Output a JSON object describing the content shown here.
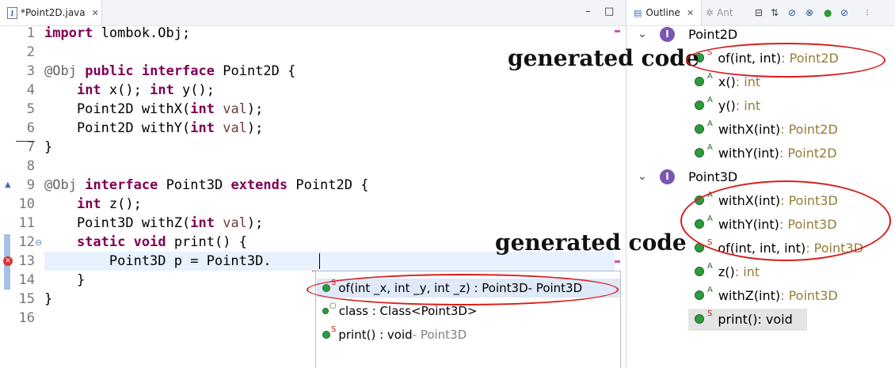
{
  "editor": {
    "tab_title": "*Point2D.java",
    "tab_close": "✕",
    "minimize": "–",
    "maximize": "□",
    "lines": [
      {
        "num": "1",
        "tokens": [
          {
            "t": "import",
            "c": "kw"
          },
          {
            "t": " lombok.Obj;",
            "c": ""
          }
        ]
      },
      {
        "num": "2",
        "tokens": []
      },
      {
        "num": "3",
        "tokens": [
          {
            "t": "@Obj",
            "c": "ann"
          },
          {
            "t": " ",
            "c": ""
          },
          {
            "t": "public",
            "c": "kw"
          },
          {
            "t": " ",
            "c": ""
          },
          {
            "t": "interface",
            "c": "kw"
          },
          {
            "t": " Point2D {",
            "c": ""
          }
        ]
      },
      {
        "num": "4",
        "tokens": [
          {
            "t": "    ",
            "c": ""
          },
          {
            "t": "int",
            "c": "kw"
          },
          {
            "t": " x(); ",
            "c": ""
          },
          {
            "t": "int",
            "c": "kw"
          },
          {
            "t": " y();",
            "c": ""
          }
        ]
      },
      {
        "num": "5",
        "tokens": [
          {
            "t": "    Point2D withX(",
            "c": ""
          },
          {
            "t": "int",
            "c": "kw"
          },
          {
            "t": " ",
            "c": ""
          },
          {
            "t": "val",
            "c": "param"
          },
          {
            "t": ");",
            "c": ""
          }
        ]
      },
      {
        "num": "6",
        "tokens": [
          {
            "t": "    Point2D withY(",
            "c": ""
          },
          {
            "t": "int",
            "c": "kw"
          },
          {
            "t": " ",
            "c": ""
          },
          {
            "t": "val",
            "c": "param"
          },
          {
            "t": ");",
            "c": ""
          }
        ]
      },
      {
        "num": "7",
        "tokens": [
          {
            "t": "}",
            "c": ""
          }
        ]
      },
      {
        "num": "8",
        "tokens": []
      },
      {
        "num": "9",
        "tokens": [
          {
            "t": "@Obj",
            "c": "ann"
          },
          {
            "t": " ",
            "c": ""
          },
          {
            "t": "interface",
            "c": "kw"
          },
          {
            "t": " Point3D ",
            "c": ""
          },
          {
            "t": "extends",
            "c": "kw"
          },
          {
            "t": " Point2D {",
            "c": ""
          }
        ]
      },
      {
        "num": "10",
        "tokens": [
          {
            "t": "    ",
            "c": ""
          },
          {
            "t": "int",
            "c": "kw"
          },
          {
            "t": " z();",
            "c": ""
          }
        ]
      },
      {
        "num": "11",
        "tokens": [
          {
            "t": "    Point3D withZ(",
            "c": ""
          },
          {
            "t": "int",
            "c": "kw"
          },
          {
            "t": " ",
            "c": ""
          },
          {
            "t": "val",
            "c": "param"
          },
          {
            "t": ");",
            "c": ""
          }
        ]
      },
      {
        "num": "12",
        "tokens": [
          {
            "t": "    ",
            "c": ""
          },
          {
            "t": "static",
            "c": "kw"
          },
          {
            "t": " ",
            "c": ""
          },
          {
            "t": "void",
            "c": "kw"
          },
          {
            "t": " print() {",
            "c": ""
          }
        ]
      },
      {
        "num": "13",
        "tokens": [
          {
            "t": "        Point3D p = Point3D.",
            "c": ""
          }
        ]
      },
      {
        "num": "14",
        "tokens": [
          {
            "t": "    }",
            "c": ""
          }
        ]
      },
      {
        "num": "15",
        "tokens": [
          {
            "t": "}",
            "c": ""
          }
        ]
      },
      {
        "num": "16",
        "tokens": []
      }
    ]
  },
  "completion": {
    "items": [
      {
        "label": "of(int _x, int _y, int _z) : Point3D",
        "suffix": " - Point3D",
        "icon": "static-method-icon",
        "selected": true
      },
      {
        "label": "class : Class<Point3D>",
        "suffix": "",
        "icon": "class-literal-icon",
        "selected": false
      },
      {
        "label": "print() : void",
        "suffix": " - Point3D",
        "icon": "static-method-icon",
        "selected": false
      }
    ]
  },
  "outline": {
    "tab_title": "Outline",
    "tab_close": "✕",
    "tab2_title": "Ant",
    "toolbar_icons": [
      "collapse-all-icon",
      "sort-icon",
      "hide-fields-icon",
      "hide-static-icon",
      "hide-nonpublic-icon",
      "hide-local-types-icon",
      "view-menu-icon"
    ],
    "nodes": [
      {
        "kind": "type",
        "label": "Point2D",
        "icon": "interface-icon"
      },
      {
        "kind": "member",
        "mod": "S",
        "name": "of(int, int)",
        "type": " : Point2D"
      },
      {
        "kind": "member",
        "mod": "A",
        "name": "x()",
        "type": " : int"
      },
      {
        "kind": "member",
        "mod": "A",
        "name": "y()",
        "type": " : int"
      },
      {
        "kind": "member",
        "mod": "A",
        "name": "withX(int)",
        "type": " : Point2D"
      },
      {
        "kind": "member",
        "mod": "A",
        "name": "withY(int)",
        "type": " : Point2D"
      },
      {
        "kind": "type",
        "label": "Point3D",
        "icon": "interface-icon"
      },
      {
        "kind": "member",
        "mod": "A",
        "name": "withX(int)",
        "type": " : Point3D"
      },
      {
        "kind": "member",
        "mod": "A",
        "name": "withY(int)",
        "type": " : Point3D"
      },
      {
        "kind": "member",
        "mod": "S",
        "name": "of(int, int, int)",
        "type": " : Point3D"
      },
      {
        "kind": "member",
        "mod": "A",
        "name": "z()",
        "type": " : int"
      },
      {
        "kind": "member",
        "mod": "A",
        "name": "withZ(int)",
        "type": " : Point3D"
      },
      {
        "kind": "member",
        "mod": "S",
        "name": "print()",
        "type": " : void"
      }
    ]
  },
  "annotations": {
    "note1": "generated code",
    "note2": "generated code"
  },
  "colors": {
    "keyword": "#7f0055",
    "annotation_ellipse": "#d81e1e",
    "method_dot": "#2e9a3e"
  }
}
